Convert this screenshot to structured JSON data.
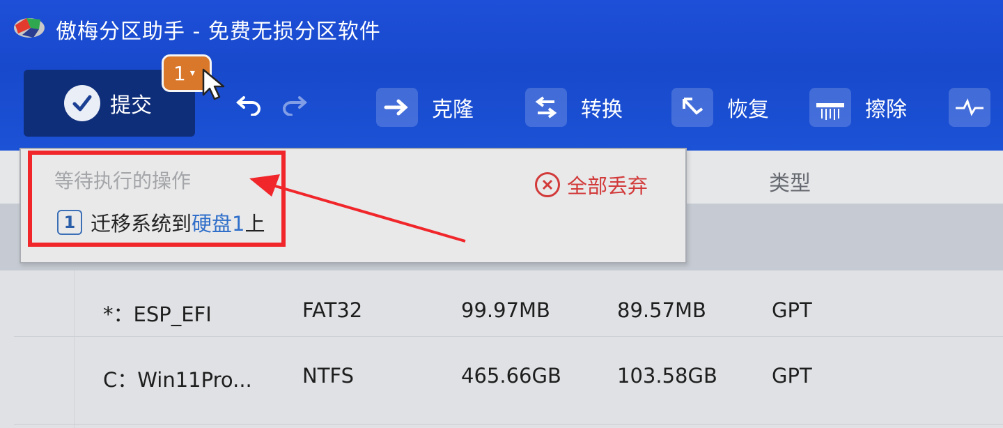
{
  "window": {
    "title": "傲梅分区助手 - 免费无损分区软件"
  },
  "toolbar": {
    "commit_label": "提交",
    "pending_count": "1",
    "clone_label": "克隆",
    "convert_label": "转换",
    "recover_label": "恢复",
    "wipe_label": "擦除"
  },
  "pending_popup": {
    "title": "等待执行的操作",
    "discard_all_label": "全部丢弃",
    "operations": [
      {
        "number": "1",
        "text_before": "迁移系统到",
        "link_text": "硬盘1",
        "text_after": "上"
      }
    ]
  },
  "table": {
    "header_type": "类型",
    "rows": [
      {
        "partition": "*：ESP_EFI",
        "filesystem": "FAT32",
        "capacity": "99.97MB",
        "free": "89.57MB",
        "type": "GPT"
      },
      {
        "partition": "C：Win11Pro...",
        "filesystem": "NTFS",
        "capacity": "465.66GB",
        "free": "103.58GB",
        "type": "GPT"
      }
    ]
  },
  "colors": {
    "title_bar_blue": "#1d4fd8",
    "commit_button_bg": "#0f2e7a",
    "badge_orange": "#d9772b",
    "annotation_red": "#f0262a",
    "discard_red": "#d23a3a",
    "link_blue": "#2f6fc9"
  },
  "icons": {
    "logo": "app-logo",
    "commit": "checkmark-icon",
    "undo": "undo-icon",
    "redo": "redo-icon",
    "clone": "arrow-right-icon",
    "convert": "swap-arrows-icon",
    "recover": "recover-arrow-icon",
    "wipe": "shredder-icon",
    "more": "pulse-icon",
    "discard": "close-circle-icon"
  }
}
